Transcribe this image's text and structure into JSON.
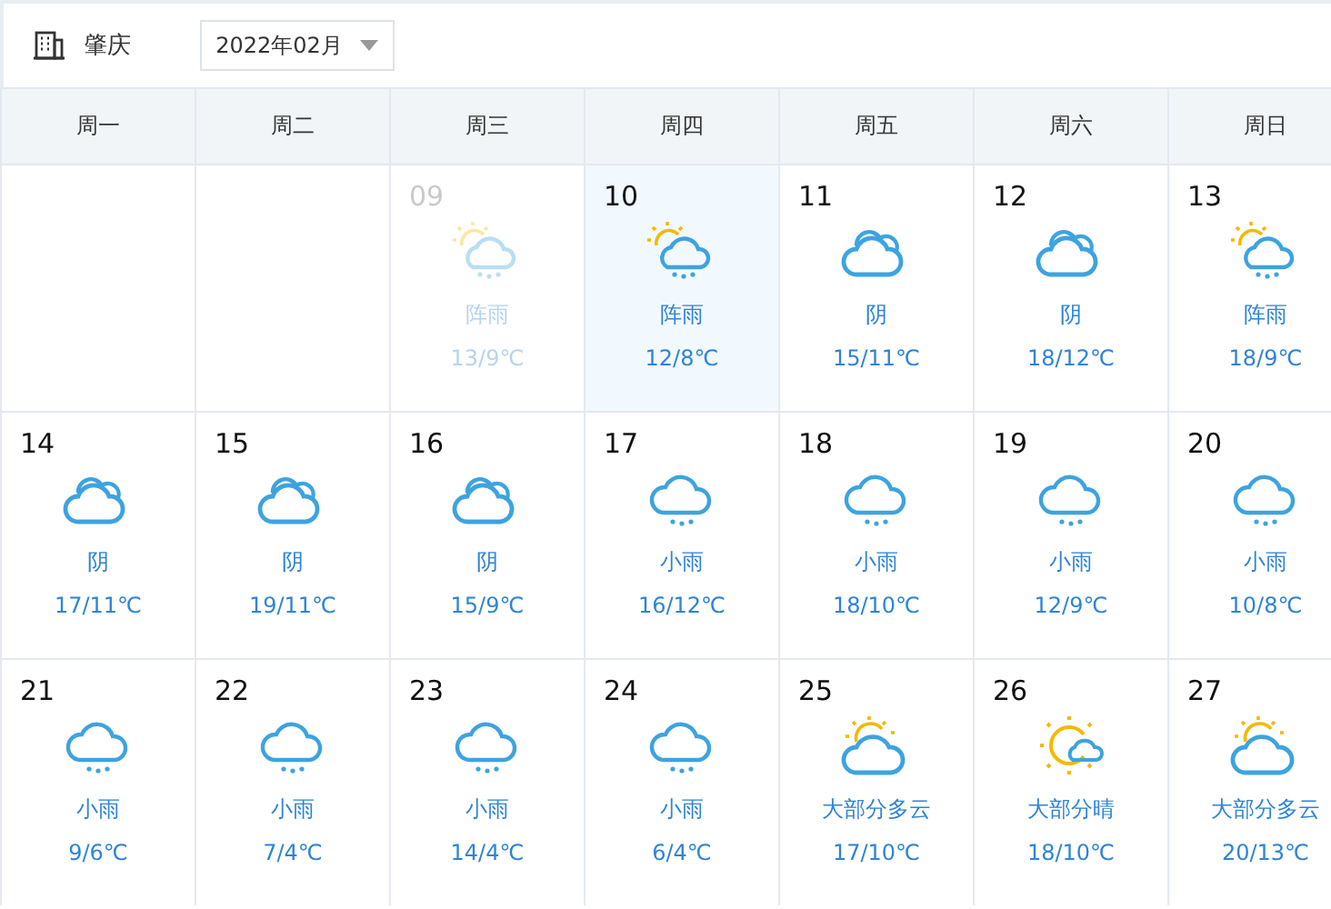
{
  "location": {
    "city": "肇庆"
  },
  "month_picker": {
    "value": "2022年02月"
  },
  "weekdays": [
    "周一",
    "周二",
    "周三",
    "周四",
    "周五",
    "周六",
    "周日"
  ],
  "weeks": [
    {
      "days": [
        {
          "date": "09",
          "weather": "阵雨",
          "temp": "13/9℃",
          "kind": "shower",
          "past": true,
          "selected": false
        },
        {
          "date": "10",
          "weather": "阵雨",
          "temp": "12/8℃",
          "kind": "shower",
          "past": false,
          "selected": true
        },
        {
          "date": "11",
          "weather": "阴",
          "temp": "15/11℃",
          "kind": "overcast",
          "past": false,
          "selected": false
        },
        {
          "date": "12",
          "weather": "阴",
          "temp": "18/12℃",
          "kind": "overcast",
          "past": false,
          "selected": false
        },
        {
          "date": "13",
          "weather": "阵雨",
          "temp": "18/9℃",
          "kind": "shower",
          "past": false,
          "selected": false
        }
      ]
    },
    {
      "days": [
        {
          "date": "14",
          "weather": "阴",
          "temp": "17/11℃",
          "kind": "overcast",
          "past": false,
          "selected": false
        },
        {
          "date": "15",
          "weather": "阴",
          "temp": "19/11℃",
          "kind": "overcast",
          "past": false,
          "selected": false
        },
        {
          "date": "16",
          "weather": "阴",
          "temp": "15/9℃",
          "kind": "overcast",
          "past": false,
          "selected": false
        },
        {
          "date": "17",
          "weather": "小雨",
          "temp": "16/12℃",
          "kind": "rain",
          "past": false,
          "selected": false
        },
        {
          "date": "18",
          "weather": "小雨",
          "temp": "18/10℃",
          "kind": "rain",
          "past": false,
          "selected": false
        },
        {
          "date": "19",
          "weather": "小雨",
          "temp": "12/9℃",
          "kind": "rain",
          "past": false,
          "selected": false
        },
        {
          "date": "20",
          "weather": "小雨",
          "temp": "10/8℃",
          "kind": "rain",
          "past": false,
          "selected": false
        }
      ]
    },
    {
      "days": [
        {
          "date": "21",
          "weather": "小雨",
          "temp": "9/6℃",
          "kind": "rain",
          "past": false,
          "selected": false
        },
        {
          "date": "22",
          "weather": "小雨",
          "temp": "7/4℃",
          "kind": "rain",
          "past": false,
          "selected": false
        },
        {
          "date": "23",
          "weather": "小雨",
          "temp": "14/4℃",
          "kind": "rain",
          "past": false,
          "selected": false
        },
        {
          "date": "24",
          "weather": "小雨",
          "temp": "6/4℃",
          "kind": "rain",
          "past": false,
          "selected": false
        },
        {
          "date": "25",
          "weather": "大部分多云",
          "temp": "17/10℃",
          "kind": "mostly-cloudy",
          "past": false,
          "selected": false
        },
        {
          "date": "26",
          "weather": "大部分晴",
          "temp": "18/10℃",
          "kind": "mostly-sunny",
          "past": false,
          "selected": false
        },
        {
          "date": "27",
          "weather": "大部分多云",
          "temp": "20/13℃",
          "kind": "mostly-cloudy",
          "past": false,
          "selected": false
        }
      ]
    }
  ]
}
